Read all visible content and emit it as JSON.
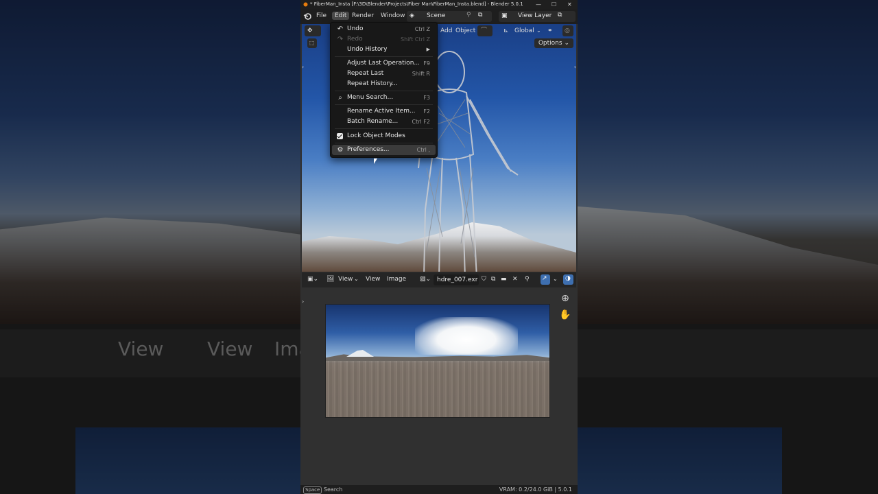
{
  "window": {
    "title": "* FiberMan_Insta [F:\\3D\\Blender\\Projects\\Fiber Man\\FiberMan_Insta.blend] - Blender 5.0.1"
  },
  "menubar": {
    "items": [
      "File",
      "Edit",
      "Render",
      "Window"
    ],
    "scene": "Scene",
    "view_layer": "View Layer"
  },
  "viewport_header": {
    "add": "Add",
    "object": "Object",
    "orientation": "Global",
    "options": "Options"
  },
  "edit_menu": {
    "items": [
      {
        "label": "Undo",
        "shortcut": "Ctrl Z",
        "icon": "undo-icon"
      },
      {
        "label": "Redo",
        "shortcut": "Shift Ctrl Z",
        "icon": "redo-icon"
      },
      {
        "label": "Undo History",
        "shortcut": "",
        "icon": ""
      },
      {
        "label": "Adjust Last Operation...",
        "shortcut": "F9",
        "icon": ""
      },
      {
        "label": "Repeat Last",
        "shortcut": "Shift R",
        "icon": ""
      },
      {
        "label": "Repeat History...",
        "shortcut": "",
        "icon": ""
      },
      {
        "label": "Menu Search...",
        "shortcut": "F3",
        "icon": "search-icon"
      },
      {
        "label": "Rename Active Item...",
        "shortcut": "F2",
        "icon": ""
      },
      {
        "label": "Batch Rename...",
        "shortcut": "Ctrl F2",
        "icon": ""
      },
      {
        "label": "Lock Object Modes",
        "shortcut": "",
        "icon": "checkbox-icon"
      },
      {
        "label": "Preferences...",
        "shortcut": "Ctrl ,",
        "icon": "gear-icon"
      }
    ]
  },
  "image_editor": {
    "view_menu": "View",
    "view": "View",
    "image": "Image",
    "image_name": "hdre_007.exr"
  },
  "statusbar": {
    "key": "Space",
    "action": "Search",
    "vram": "VRAM: 0.2/24.0 GiB | 5.0.1"
  },
  "background": {
    "view_a": "View",
    "view_b": "View",
    "image_partial": "Ima"
  }
}
